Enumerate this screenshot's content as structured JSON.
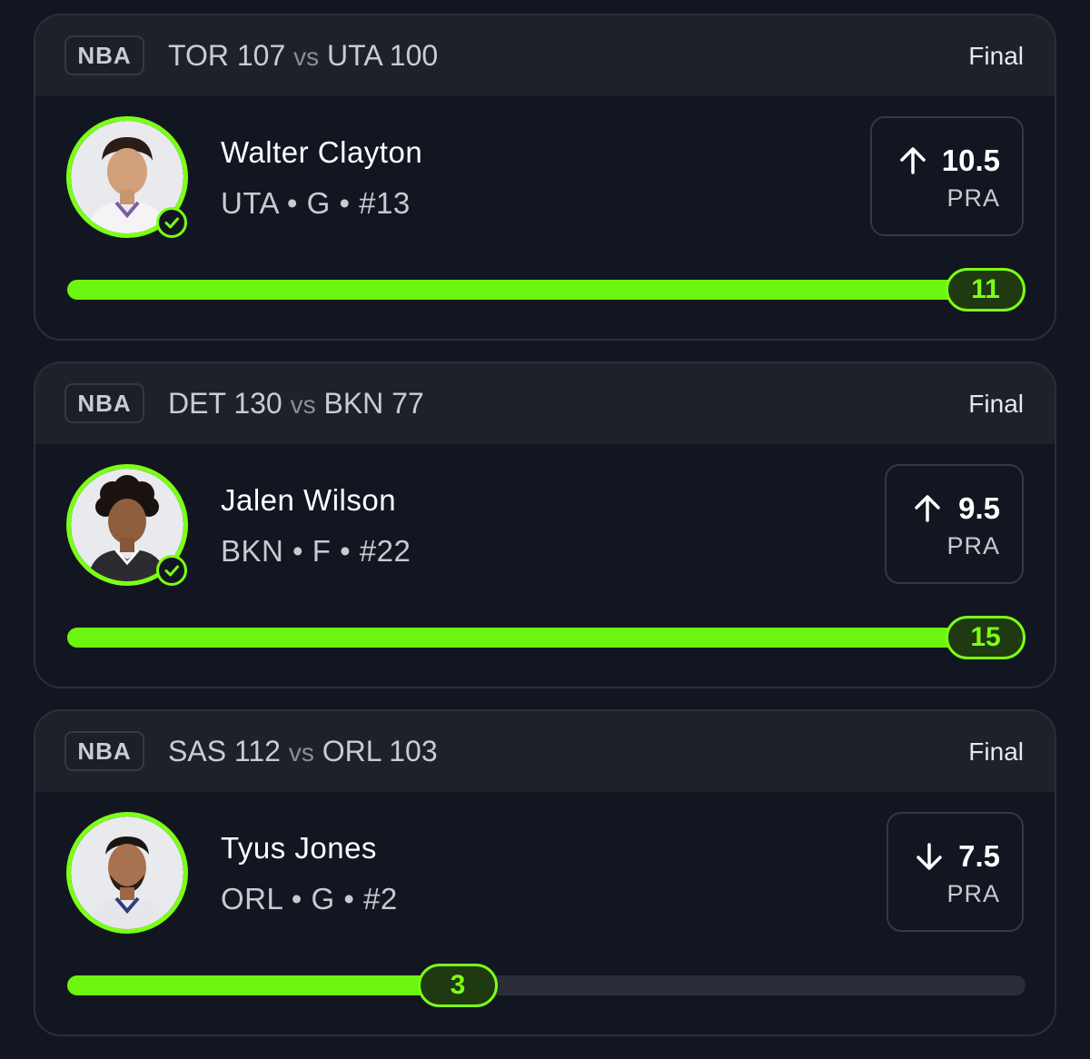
{
  "colors": {
    "accent": "#7cff17",
    "progress_fill": "#6cf50f",
    "background": "#131620",
    "card_header": "#1e212a",
    "track": "#2a2e38"
  },
  "cards": [
    {
      "league": "NBA",
      "team1": "TOR",
      "score1": "107",
      "vs": "vs",
      "team2": "UTA",
      "score2": "100",
      "status": "Final",
      "player_name": "Walter Clayton",
      "player_meta": "UTA • G • #13",
      "verified": true,
      "avatar_icon": "player-headshot-icon",
      "direction": "up",
      "direction_icon": "arrow-up-icon",
      "line_value": "10.5",
      "line_stat": "PRA",
      "result": "11",
      "progress_fraction": 1.0
    },
    {
      "league": "NBA",
      "team1": "DET",
      "score1": "130",
      "vs": "vs",
      "team2": "BKN",
      "score2": "77",
      "status": "Final",
      "player_name": "Jalen Wilson",
      "player_meta": "BKN • F • #22",
      "verified": true,
      "avatar_icon": "player-headshot-icon",
      "direction": "up",
      "direction_icon": "arrow-up-icon",
      "line_value": "9.5",
      "line_stat": "PRA",
      "result": "15",
      "progress_fraction": 1.0
    },
    {
      "league": "NBA",
      "team1": "SAS",
      "score1": "112",
      "vs": "vs",
      "team2": "ORL",
      "score2": "103",
      "status": "Final",
      "player_name": "Tyus Jones",
      "player_meta": "ORL • G • #2",
      "verified": false,
      "avatar_icon": "player-headshot-icon",
      "direction": "down",
      "direction_icon": "arrow-down-icon",
      "line_value": "7.5",
      "line_stat": "PRA",
      "result": "3",
      "progress_fraction": 0.4
    }
  ]
}
